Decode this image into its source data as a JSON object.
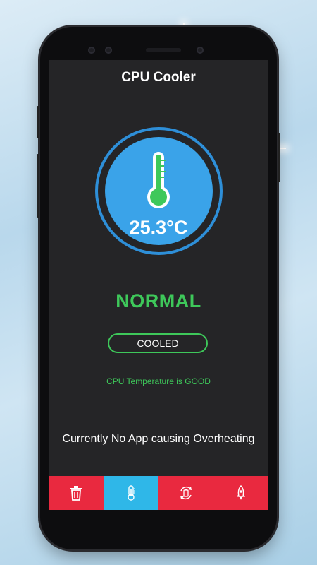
{
  "app": {
    "title": "CPU Cooler"
  },
  "gauge": {
    "temperature": "25.3°C"
  },
  "status": {
    "label": "NORMAL",
    "button_label": "COOLED",
    "message": "CPU Temperature is GOOD"
  },
  "apps": {
    "message": "Currently No App causing Overheating"
  },
  "tabs": [
    {
      "icon": "trash-icon",
      "active": false
    },
    {
      "icon": "thermometer-icon",
      "active": true
    },
    {
      "icon": "battery-refresh-icon",
      "active": false
    },
    {
      "icon": "rocket-icon",
      "active": false
    }
  ],
  "colors": {
    "accent_green": "#3ec85a",
    "gauge_blue": "#3aa3e9",
    "tab_red": "#e9293f",
    "tab_active": "#2fb7e8"
  }
}
